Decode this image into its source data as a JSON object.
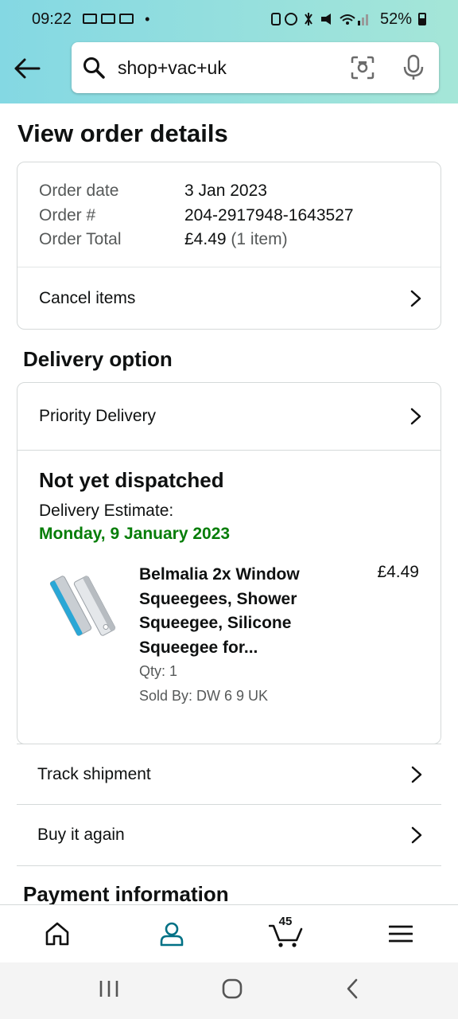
{
  "status_bar": {
    "time": "09:22",
    "battery": "52%"
  },
  "search": {
    "query": "shop+vac+uk"
  },
  "page": {
    "title": "View order details"
  },
  "order": {
    "rows": [
      {
        "label": "Order date",
        "value": "3 Jan 2023",
        "extra": ""
      },
      {
        "label": "Order #",
        "value": "204-2917948-1643527",
        "extra": ""
      },
      {
        "label": "Order Total",
        "value": "£4.49",
        "extra": "(1 item)"
      }
    ],
    "cancel_label": "Cancel items"
  },
  "delivery": {
    "section_title": "Delivery option",
    "option": "Priority Delivery",
    "status": "Not yet dispatched",
    "estimate_label": "Delivery Estimate:",
    "estimate_date": "Monday, 9 January 2023",
    "item": {
      "title": "Belmalia 2x Window Squeegees, Shower Squeegee, Silicone Squeegee for...",
      "price": "£4.49",
      "qty": "Qty: 1",
      "seller": "Sold By: DW 6 9 UK"
    }
  },
  "actions": {
    "track": "Track shipment",
    "buy_again": "Buy it again"
  },
  "payment": {
    "section_title": "Payment information"
  },
  "nav": {
    "cart_count": "45"
  },
  "colors": {
    "accent": "#007185",
    "green": "#067d08"
  }
}
